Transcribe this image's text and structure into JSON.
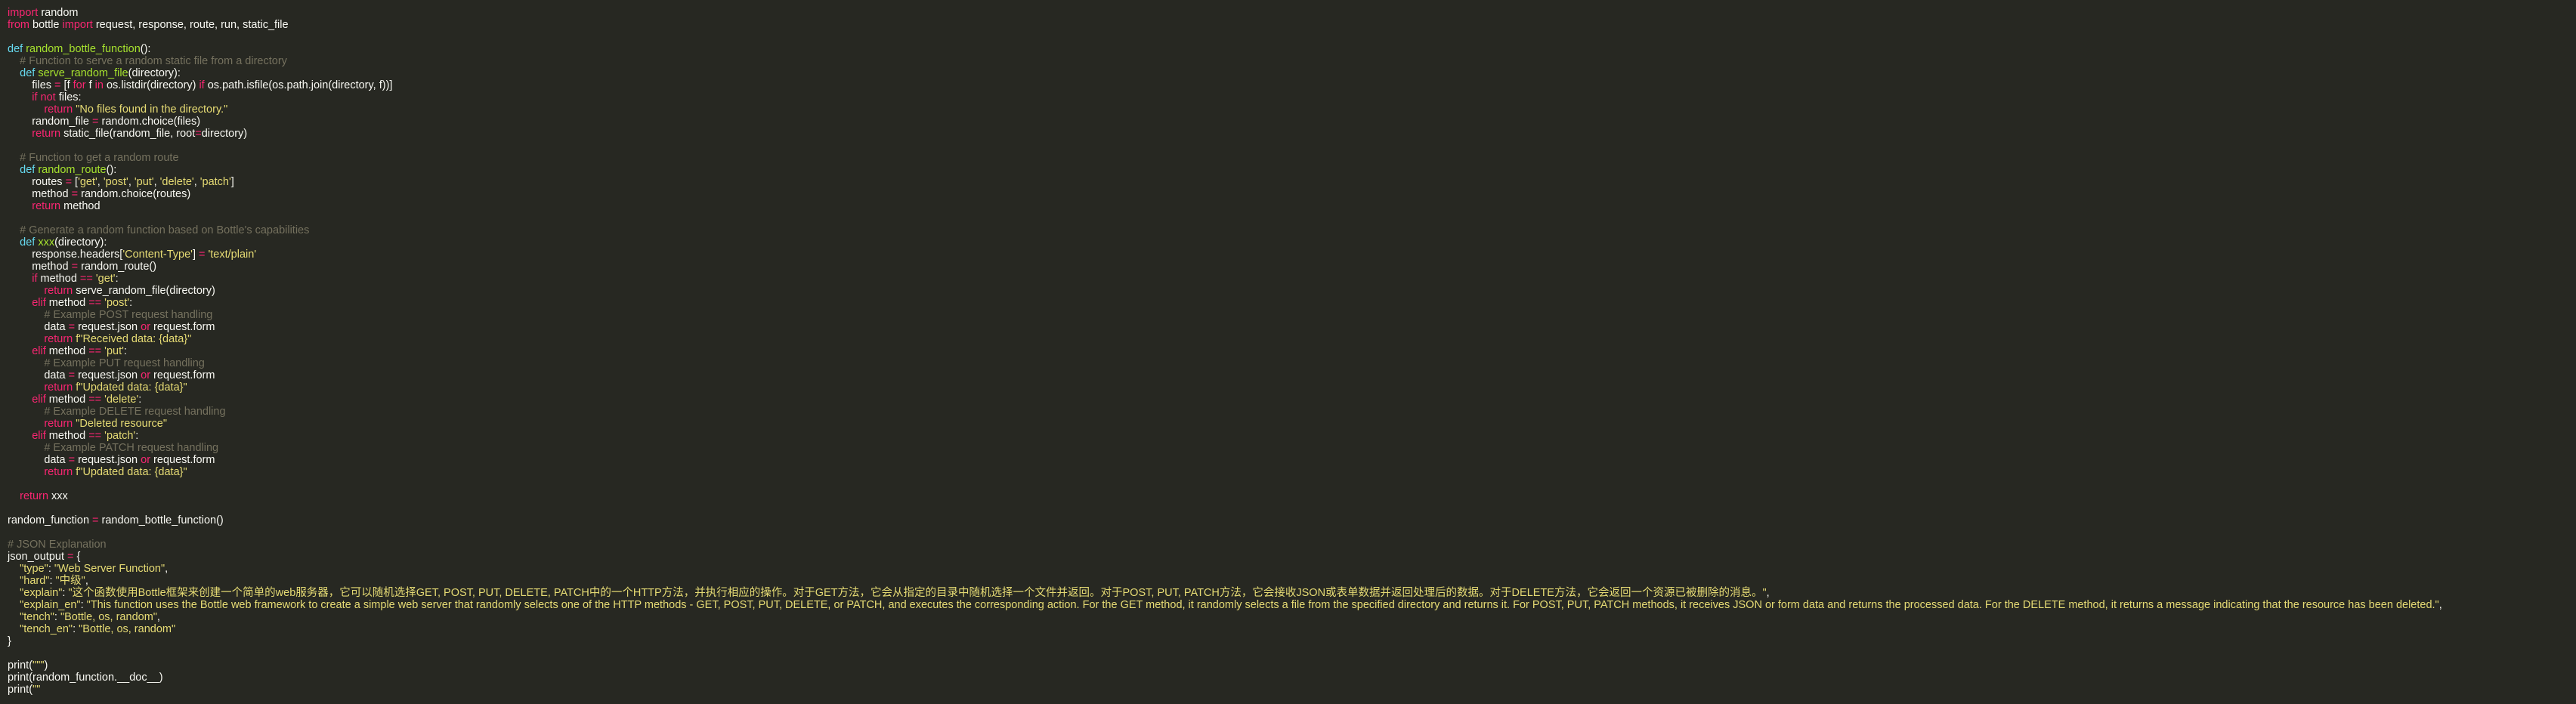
{
  "editor": {
    "language": "python",
    "theme": {
      "background": "#272822",
      "text": "#f8f8f2",
      "keyword": "#f92672",
      "def_keyword": "#66d9ef",
      "function_name": "#a6e22e",
      "string": "#e6db74",
      "comment": "#75715e"
    },
    "lines": [
      [
        [
          "keyword",
          "import"
        ],
        [
          "plain",
          " random"
        ]
      ],
      [
        [
          "keyword",
          "from"
        ],
        [
          "plain",
          " bottle "
        ],
        [
          "keyword",
          "import"
        ],
        [
          "plain",
          " request, response, route, run, static_file"
        ]
      ],
      [],
      [
        [
          "defkw",
          "def"
        ],
        [
          "plain",
          " "
        ],
        [
          "func",
          "random_bottle_function"
        ],
        [
          "plain",
          "():"
        ]
      ],
      [
        [
          "plain",
          "    "
        ],
        [
          "comment",
          "# Function to serve a random static file from a directory"
        ]
      ],
      [
        [
          "plain",
          "    "
        ],
        [
          "defkw",
          "def"
        ],
        [
          "plain",
          " "
        ],
        [
          "func",
          "serve_random_file"
        ],
        [
          "plain",
          "(directory):"
        ]
      ],
      [
        [
          "plain",
          "        files "
        ],
        [
          "op",
          "="
        ],
        [
          "plain",
          " [f "
        ],
        [
          "keyword",
          "for"
        ],
        [
          "plain",
          " f "
        ],
        [
          "keyword",
          "in"
        ],
        [
          "plain",
          " os.listdir(directory) "
        ],
        [
          "keyword",
          "if"
        ],
        [
          "plain",
          " os.path.isfile(os.path.join(directory, f))]"
        ]
      ],
      [
        [
          "plain",
          "        "
        ],
        [
          "keyword",
          "if"
        ],
        [
          "plain",
          " "
        ],
        [
          "keyword",
          "not"
        ],
        [
          "plain",
          " files:"
        ]
      ],
      [
        [
          "plain",
          "            "
        ],
        [
          "keyword",
          "return"
        ],
        [
          "plain",
          " "
        ],
        [
          "string",
          "\"No files found in the directory.\""
        ]
      ],
      [
        [
          "plain",
          "        random_file "
        ],
        [
          "op",
          "="
        ],
        [
          "plain",
          " random.choice(files)"
        ]
      ],
      [
        [
          "plain",
          "        "
        ],
        [
          "keyword",
          "return"
        ],
        [
          "plain",
          " static_file(random_file, root"
        ],
        [
          "op",
          "="
        ],
        [
          "plain",
          "directory)"
        ]
      ],
      [],
      [
        [
          "plain",
          "    "
        ],
        [
          "comment",
          "# Function to get a random route"
        ]
      ],
      [
        [
          "plain",
          "    "
        ],
        [
          "defkw",
          "def"
        ],
        [
          "plain",
          " "
        ],
        [
          "func",
          "random_route"
        ],
        [
          "plain",
          "():"
        ]
      ],
      [
        [
          "plain",
          "        routes "
        ],
        [
          "op",
          "="
        ],
        [
          "plain",
          " ["
        ],
        [
          "string",
          "'get'"
        ],
        [
          "plain",
          ", "
        ],
        [
          "string",
          "'post'"
        ],
        [
          "plain",
          ", "
        ],
        [
          "string",
          "'put'"
        ],
        [
          "plain",
          ", "
        ],
        [
          "string",
          "'delete'"
        ],
        [
          "plain",
          ", "
        ],
        [
          "string",
          "'patch'"
        ],
        [
          "plain",
          "]"
        ]
      ],
      [
        [
          "plain",
          "        method "
        ],
        [
          "op",
          "="
        ],
        [
          "plain",
          " random.choice(routes)"
        ]
      ],
      [
        [
          "plain",
          "        "
        ],
        [
          "keyword",
          "return"
        ],
        [
          "plain",
          " method"
        ]
      ],
      [],
      [
        [
          "plain",
          "    "
        ],
        [
          "comment",
          "# Generate a random function based on Bottle's capabilities"
        ]
      ],
      [
        [
          "plain",
          "    "
        ],
        [
          "defkw",
          "def"
        ],
        [
          "plain",
          " "
        ],
        [
          "func",
          "xxx"
        ],
        [
          "plain",
          "(directory):"
        ]
      ],
      [
        [
          "plain",
          "        response.headers["
        ],
        [
          "string",
          "'Content-Type'"
        ],
        [
          "plain",
          "] "
        ],
        [
          "op",
          "="
        ],
        [
          "plain",
          " "
        ],
        [
          "string",
          "'text/plain'"
        ]
      ],
      [
        [
          "plain",
          "        method "
        ],
        [
          "op",
          "="
        ],
        [
          "plain",
          " random_route()"
        ]
      ],
      [
        [
          "plain",
          "        "
        ],
        [
          "keyword",
          "if"
        ],
        [
          "plain",
          " method "
        ],
        [
          "op",
          "=="
        ],
        [
          "plain",
          " "
        ],
        [
          "string",
          "'get'"
        ],
        [
          "plain",
          ":"
        ]
      ],
      [
        [
          "plain",
          "            "
        ],
        [
          "keyword",
          "return"
        ],
        [
          "plain",
          " serve_random_file(directory)"
        ]
      ],
      [
        [
          "plain",
          "        "
        ],
        [
          "keyword",
          "elif"
        ],
        [
          "plain",
          " method "
        ],
        [
          "op",
          "=="
        ],
        [
          "plain",
          " "
        ],
        [
          "string",
          "'post'"
        ],
        [
          "plain",
          ":"
        ]
      ],
      [
        [
          "plain",
          "            "
        ],
        [
          "comment",
          "# Example POST request handling"
        ]
      ],
      [
        [
          "plain",
          "            data "
        ],
        [
          "op",
          "="
        ],
        [
          "plain",
          " request.json "
        ],
        [
          "keyword",
          "or"
        ],
        [
          "plain",
          " request.form"
        ]
      ],
      [
        [
          "plain",
          "            "
        ],
        [
          "keyword",
          "return"
        ],
        [
          "plain",
          " "
        ],
        [
          "string",
          "f\"Received data: {data}\""
        ]
      ],
      [
        [
          "plain",
          "        "
        ],
        [
          "keyword",
          "elif"
        ],
        [
          "plain",
          " method "
        ],
        [
          "op",
          "=="
        ],
        [
          "plain",
          " "
        ],
        [
          "string",
          "'put'"
        ],
        [
          "plain",
          ":"
        ]
      ],
      [
        [
          "plain",
          "            "
        ],
        [
          "comment",
          "# Example PUT request handling"
        ]
      ],
      [
        [
          "plain",
          "            data "
        ],
        [
          "op",
          "="
        ],
        [
          "plain",
          " request.json "
        ],
        [
          "keyword",
          "or"
        ],
        [
          "plain",
          " request.form"
        ]
      ],
      [
        [
          "plain",
          "            "
        ],
        [
          "keyword",
          "return"
        ],
        [
          "plain",
          " "
        ],
        [
          "string",
          "f\"Updated data: {data}\""
        ]
      ],
      [
        [
          "plain",
          "        "
        ],
        [
          "keyword",
          "elif"
        ],
        [
          "plain",
          " method "
        ],
        [
          "op",
          "=="
        ],
        [
          "plain",
          " "
        ],
        [
          "string",
          "'delete'"
        ],
        [
          "plain",
          ":"
        ]
      ],
      [
        [
          "plain",
          "            "
        ],
        [
          "comment",
          "# Example DELETE request handling"
        ]
      ],
      [
        [
          "plain",
          "            "
        ],
        [
          "keyword",
          "return"
        ],
        [
          "plain",
          " "
        ],
        [
          "string",
          "\"Deleted resource\""
        ]
      ],
      [
        [
          "plain",
          "        "
        ],
        [
          "keyword",
          "elif"
        ],
        [
          "plain",
          " method "
        ],
        [
          "op",
          "=="
        ],
        [
          "plain",
          " "
        ],
        [
          "string",
          "'patch'"
        ],
        [
          "plain",
          ":"
        ]
      ],
      [
        [
          "plain",
          "            "
        ],
        [
          "comment",
          "# Example PATCH request handling"
        ]
      ],
      [
        [
          "plain",
          "            data "
        ],
        [
          "op",
          "="
        ],
        [
          "plain",
          " request.json "
        ],
        [
          "keyword",
          "or"
        ],
        [
          "plain",
          " request.form"
        ]
      ],
      [
        [
          "plain",
          "            "
        ],
        [
          "keyword",
          "return"
        ],
        [
          "plain",
          " "
        ],
        [
          "string",
          "f\"Updated data: {data}\""
        ]
      ],
      [],
      [
        [
          "plain",
          "    "
        ],
        [
          "keyword",
          "return"
        ],
        [
          "plain",
          " xxx"
        ]
      ],
      [],
      [
        [
          "plain",
          "random_function "
        ],
        [
          "op",
          "="
        ],
        [
          "plain",
          " random_bottle_function()"
        ]
      ],
      [],
      [
        [
          "comment",
          "# JSON Explanation"
        ]
      ],
      [
        [
          "plain",
          "json_output "
        ],
        [
          "op",
          "="
        ],
        [
          "plain",
          " {"
        ]
      ],
      [
        [
          "plain",
          "    "
        ],
        [
          "string",
          "\"type\""
        ],
        [
          "plain",
          ": "
        ],
        [
          "string",
          "\"Web Server Function\""
        ],
        [
          "plain",
          ","
        ]
      ],
      [
        [
          "plain",
          "    "
        ],
        [
          "string",
          "\"hard\""
        ],
        [
          "plain",
          ": "
        ],
        [
          "string",
          "\"中级\""
        ],
        [
          "plain",
          ","
        ]
      ],
      [
        [
          "plain",
          "    "
        ],
        [
          "string",
          "\"explain\""
        ],
        [
          "plain",
          ": "
        ],
        [
          "string",
          "\"这个函数使用Bottle框架来创建一个简单的web服务器，它可以随机选择GET, POST, PUT, DELETE, PATCH中的一个HTTP方法，并执行相应的操作。对于GET方法，它会从指定的目录中随机选择一个文件并返回。对于POST, PUT, PATCH方法，它会接收JSON或表单数据并返回处理后的数据。对于DELETE方法，它会返回一个资源已被删除的消息。\""
        ],
        [
          "plain",
          ","
        ]
      ],
      [
        [
          "plain",
          "    "
        ],
        [
          "string",
          "\"explain_en\""
        ],
        [
          "plain",
          ": "
        ],
        [
          "string",
          "\"This function uses the Bottle web framework to create a simple web server that randomly selects one of the HTTP methods - GET, POST, PUT, DELETE, or PATCH, and executes the corresponding action. For the GET method, it randomly selects a file from the specified directory and returns it. For POST, PUT, PATCH methods, it receives JSON or form data and returns the processed data. For the DELETE method, it returns a message indicating that the resource has been deleted.\""
        ],
        [
          "plain",
          ","
        ]
      ],
      [
        [
          "plain",
          "    "
        ],
        [
          "string",
          "\"tench\""
        ],
        [
          "plain",
          ": "
        ],
        [
          "string",
          "\"Bottle, os, random\""
        ],
        [
          "plain",
          ","
        ]
      ],
      [
        [
          "plain",
          "    "
        ],
        [
          "string",
          "\"tench_en\""
        ],
        [
          "plain",
          ": "
        ],
        [
          "string",
          "\"Bottle, os, random\""
        ]
      ],
      [
        [
          "plain",
          "}"
        ]
      ],
      [],
      [
        [
          "plain",
          "print("
        ],
        [
          "string",
          "\"\"\""
        ],
        [
          "plain",
          ")"
        ]
      ],
      [
        [
          "plain",
          "print(random_function.__doc__)"
        ]
      ],
      [
        [
          "plain",
          "print("
        ],
        [
          "string",
          "\"\""
        ]
      ]
    ]
  }
}
